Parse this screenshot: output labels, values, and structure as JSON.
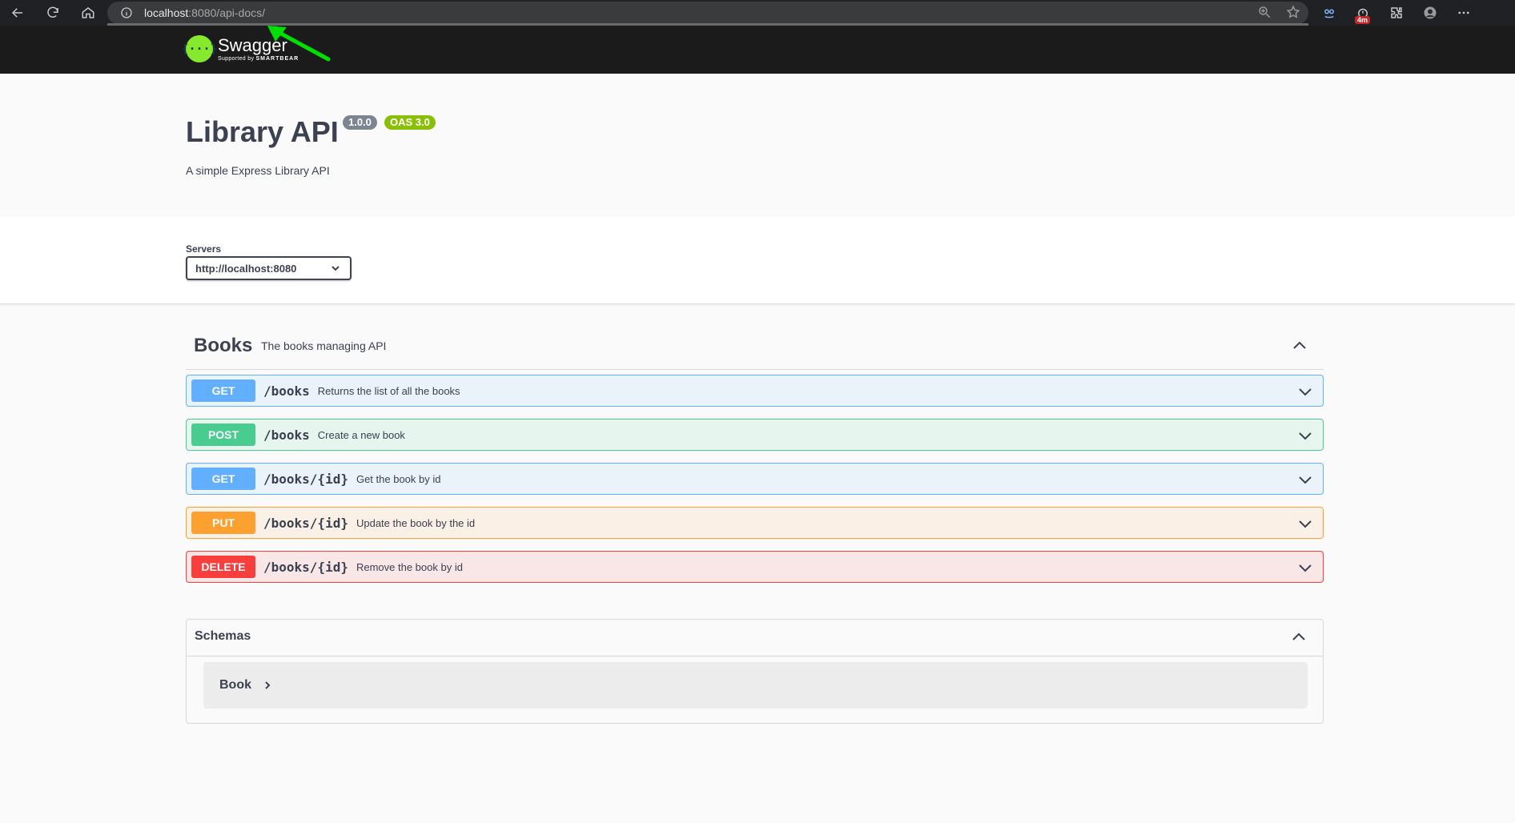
{
  "browser": {
    "url_host": "localhost",
    "url_rest": ":8080/api-docs/",
    "extension_badge": "4m"
  },
  "topbar": {
    "logo_title": "Swagger",
    "logo_sub_prefix": "Supported by",
    "logo_sub_brand": "SMARTBEAR",
    "logo_glyph": "{···}"
  },
  "info": {
    "title": "Library API",
    "version": "1.0.0",
    "oas": "OAS 3.0",
    "description": "A simple Express Library API"
  },
  "servers": {
    "label": "Servers",
    "selected": "http://localhost:8080"
  },
  "tag": {
    "name": "Books",
    "description": "The books managing API"
  },
  "operations": [
    {
      "method": "GET",
      "path": "/books",
      "summary": "Returns the list of all the books"
    },
    {
      "method": "POST",
      "path": "/books",
      "summary": "Create a new book"
    },
    {
      "method": "GET",
      "path": "/books/{id}",
      "summary": "Get the book by id"
    },
    {
      "method": "PUT",
      "path": "/books/{id}",
      "summary": "Update the book by the id"
    },
    {
      "method": "DELETE",
      "path": "/books/{id}",
      "summary": "Remove the book by id"
    }
  ],
  "schemas": {
    "title": "Schemas",
    "models": [
      {
        "name": "Book"
      }
    ]
  },
  "colors": {
    "get": "#61affe",
    "post": "#49cc90",
    "put": "#fca130",
    "delete": "#f93e3e",
    "arrow": "#00e000"
  }
}
